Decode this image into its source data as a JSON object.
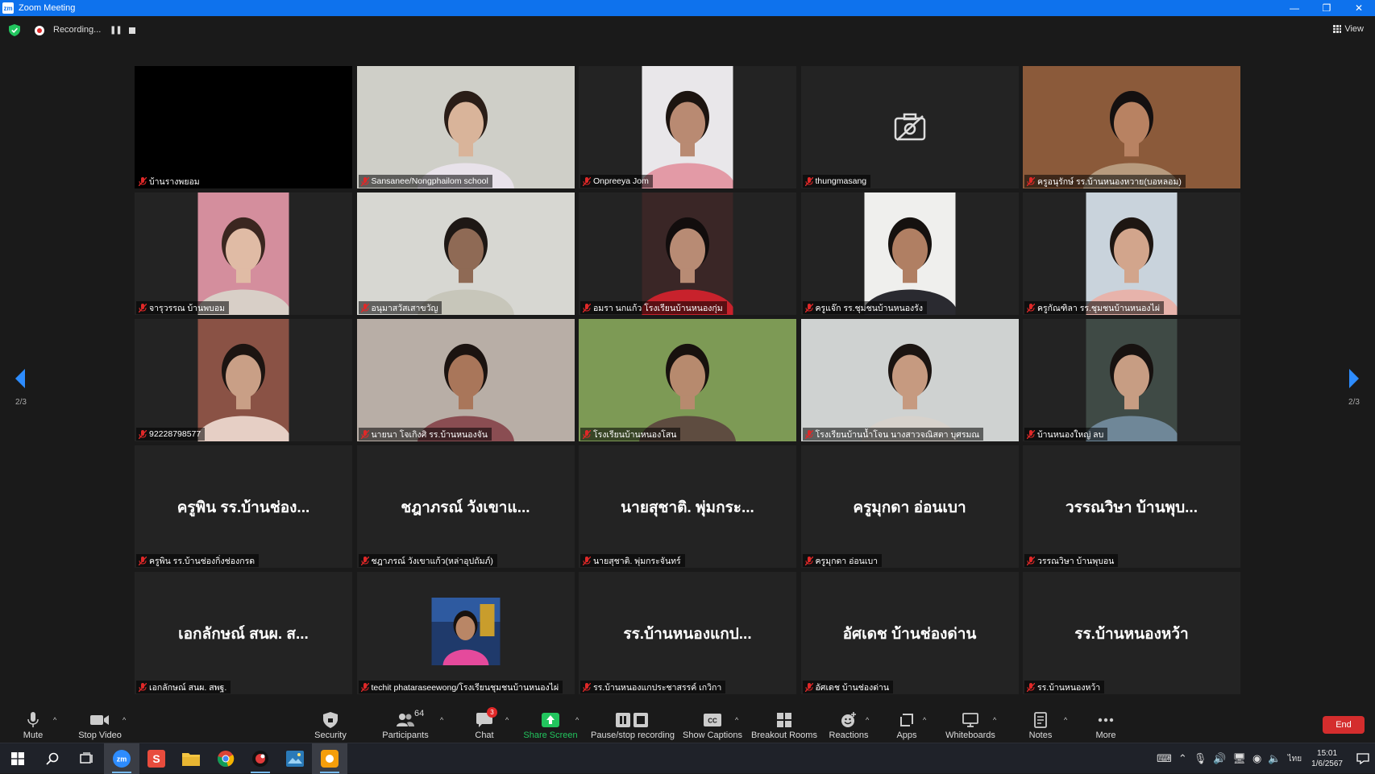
{
  "window": {
    "title": "Zoom Meeting",
    "app_icon": "zm",
    "minimize": "—",
    "restore": "❐",
    "close": "✕"
  },
  "topbar": {
    "recording_label": "Recording...",
    "pause_glyph": "❚❚",
    "view_label": "View"
  },
  "pager": {
    "page_left": "2/3",
    "page_right": "2/3"
  },
  "tiles": [
    {
      "name": "บ้านรางพยอม",
      "kind": "black"
    },
    {
      "name": "Sansanee/Nongphailom school",
      "kind": "video-full",
      "bg": "#cfcfc8",
      "skin": "#d9b49a",
      "hair": "#2a1d17",
      "cloth": "#e8e2ea"
    },
    {
      "name": "Onpreeya Jom",
      "kind": "video-center",
      "bg": "#e9e7ea",
      "skin": "#b98a72",
      "hair": "#1c1410",
      "cloth": "#e39aa6"
    },
    {
      "name": "thungmasang",
      "kind": "camoff"
    },
    {
      "name": "ครูอนุรักษ์ รร.บ้านหนองหวาย(บอหลอม)",
      "kind": "video-full",
      "bg": "#8b5a3a",
      "skin": "#b88262",
      "hair": "#141010",
      "cloth": "#b79b7e"
    },
    {
      "name": "จารุวรรณ บ้านพบอม",
      "kind": "video-center",
      "bg": "#d48e9d",
      "skin": "#e0bba5",
      "hair": "#3b2620",
      "cloth": "#d8cfc7"
    },
    {
      "name": "อนุมาสวัสเสาขวัญ",
      "kind": "video-full",
      "bg": "#d7d7d2",
      "skin": "#8f6a55",
      "hair": "#1e1815",
      "cloth": "#c7c6ba"
    },
    {
      "name": "อมรา นกแก้ว โรงเรียนบ้านหนองกุ่ม",
      "kind": "video-center",
      "bg": "#3a2626",
      "skin": "#b88b74",
      "hair": "#120d0d",
      "cloth": "#c8222c"
    },
    {
      "name": "ครูแจ๊ก รร.ชุมชนบ้านหนองรัง",
      "kind": "video-center",
      "bg": "#efefed",
      "skin": "#b07f63",
      "hair": "#15110f",
      "cloth": "#2a2a30"
    },
    {
      "name": "ครูกัณฑิลา รร.ชุมชนบ้านหนองไผ่",
      "kind": "video-center",
      "bg": "#c9d3dc",
      "skin": "#d2a58c",
      "hair": "#1e1612",
      "cloth": "#e7b3ab"
    },
    {
      "name": "92228798577",
      "kind": "video-center",
      "bg": "#8a5245",
      "skin": "#c99f86",
      "hair": "#1c1411",
      "cloth": "#e6cfc5"
    },
    {
      "name": "นายนา โจเกิงศิ รร.บ้านหนองจัน",
      "kind": "video-full",
      "bg": "#b8aea6",
      "skin": "#a9765a",
      "hair": "#1b1310",
      "cloth": "#8a4d52"
    },
    {
      "name": "โรงเรียนบ้านหนองโสน",
      "kind": "video-full",
      "bg": "#7d9a55",
      "skin": "#b78a6e",
      "hair": "#17110e",
      "cloth": "#5e4c40"
    },
    {
      "name": "โรงเรียนบ้านน้ำโจน นางสาวจณิสตา บุศรมณ",
      "kind": "video-full",
      "bg": "#cfd2d1",
      "skin": "#c69a80",
      "hair": "#1b1411",
      "cloth": "#d7d2cc"
    },
    {
      "name": "บ้านหนองใหญ่ ลบ",
      "kind": "video-center",
      "bg": "#3f4a45",
      "skin": "#c79d83",
      "hair": "#171210",
      "cloth": "#6f8798"
    },
    {
      "name": "ครูพิน รร.บ้านช่องกิ่งช่องกรด",
      "kind": "name",
      "display": "ครูพิน รร.บ้านช่อง..."
    },
    {
      "name": "ชฎาภรณ์ วังเขาแก้ว(หล่าอุปถัมภ์)",
      "kind": "name",
      "display": "ชฎาภรณ์ วังเขาแ..."
    },
    {
      "name": "นายสุชาติ. พุ่มกระจันทร์",
      "kind": "name",
      "display": "นายสุชาติ. พุ่มกระ..."
    },
    {
      "name": "ครูมุกดา อ่อนเบา",
      "kind": "name",
      "display": "ครูมุกดา อ่อนเบา"
    },
    {
      "name": "วรรณวิษา บ้านพุบอน",
      "kind": "name",
      "display": "วรรณวิษา บ้านพุบ..."
    },
    {
      "name": "เอกลักษณ์ สนผ. สพฐ.",
      "kind": "name",
      "display": "เอกลักษณ์ สนผ. ส..."
    },
    {
      "name": "techit phataraseewong/โรงเรียนชุมชนบ้านหนองไผ่",
      "kind": "avatar"
    },
    {
      "name": "รร.บ้านหนองแกประชาสรรค์ เกวิกา",
      "kind": "name",
      "display": "รร.บ้านหนองแกป..."
    },
    {
      "name": "อัศเดช บ้านช่องด่าน",
      "kind": "name",
      "display": "อัศเดช บ้านช่องด่าน"
    },
    {
      "name": "รร.บ้านหนองหว้า",
      "kind": "name",
      "display": "รร.บ้านหนองหว้า"
    }
  ],
  "toolbar": {
    "mute": "Mute",
    "stop_video": "Stop Video",
    "security": "Security",
    "participants": "Participants",
    "participants_count": "64",
    "chat": "Chat",
    "chat_badge": "3",
    "share_screen": "Share Screen",
    "pause_recording": "Pause/stop recording",
    "captions": "Show Captions",
    "breakout": "Breakout Rooms",
    "reactions": "Reactions",
    "apps": "Apps",
    "whiteboards": "Whiteboards",
    "notes": "Notes",
    "more": "More",
    "end": "End",
    "caret": "^"
  },
  "taskbar": {
    "apps": [
      "start",
      "search",
      "task-view",
      "zoom",
      "slides",
      "file-explorer",
      "chrome",
      "app-red",
      "photos",
      "app-orange"
    ],
    "clock_time": "15:01",
    "clock_date": "1/6/2567",
    "lang": "ไทย"
  },
  "colors": {
    "accent": "#0e72ed",
    "share_green": "#22c55e",
    "end_red": "#d42d2d",
    "mic_off_red": "#e02828"
  }
}
